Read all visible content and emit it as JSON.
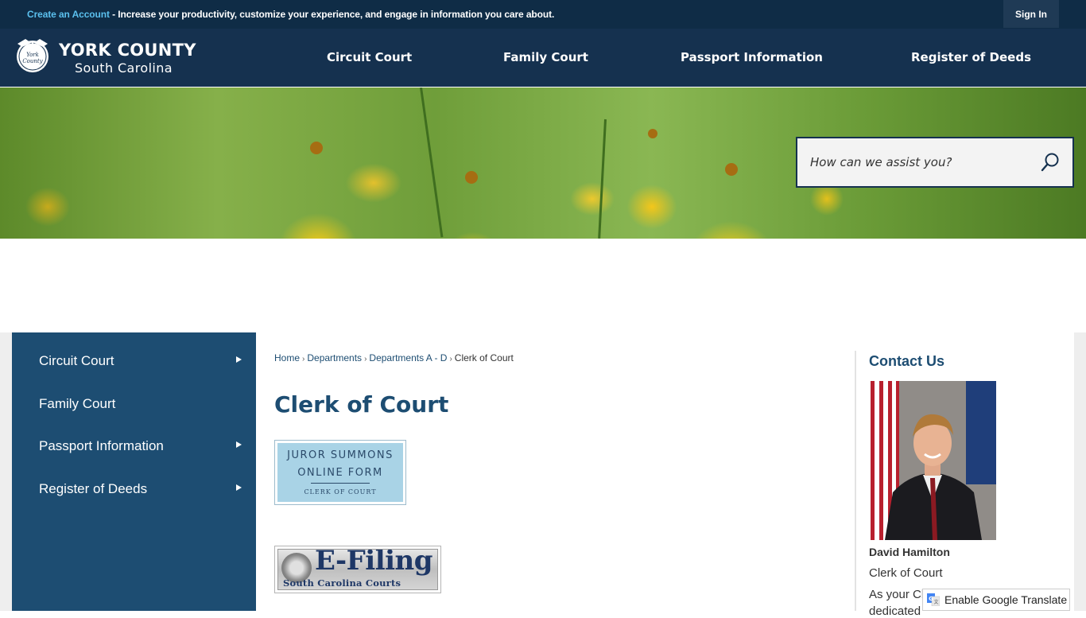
{
  "topbar": {
    "create_account_link": "Create an Account",
    "message": " - Increase your productivity, customize your experience, and engage in information you care about.",
    "sign_in_label": "Sign In"
  },
  "header": {
    "logo_title": "YORK COUNTY",
    "logo_subtitle": "South Carolina",
    "seal_text": "York County",
    "nav": [
      {
        "label": "Circuit Court"
      },
      {
        "label": "Family Court"
      },
      {
        "label": "Passport Information"
      },
      {
        "label": "Register of Deeds"
      }
    ]
  },
  "search": {
    "placeholder": "How can we assist you?",
    "value": ""
  },
  "sidenav": {
    "items": [
      {
        "label": "Circuit Court",
        "has_submenu": true
      },
      {
        "label": "Family Court",
        "has_submenu": false
      },
      {
        "label": "Passport Information",
        "has_submenu": true
      },
      {
        "label": "Register of Deeds",
        "has_submenu": true
      }
    ]
  },
  "breadcrumb": {
    "items": [
      {
        "label": "Home"
      },
      {
        "label": "Departments"
      },
      {
        "label": "Departments A - D"
      },
      {
        "label": "Clerk of Court"
      }
    ],
    "separator": "›"
  },
  "main": {
    "title": "Clerk of Court",
    "juror_graphic": {
      "line1": "JUROR SUMMONS",
      "line2": "ONLINE FORM",
      "line3": "CLERK OF COURT"
    },
    "efiling_graphic": {
      "title": "E-Filing",
      "subtitle": "South Carolina Courts"
    }
  },
  "contact": {
    "heading": "Contact Us",
    "name": "David Hamilton",
    "role": "Clerk of Court",
    "text_line1": "As your Cl",
    "text_line2": "dedicated"
  },
  "translate": {
    "label": "Enable Google Translate"
  },
  "colors": {
    "topbar_bg": "#0f2c46",
    "header_bg": "#15314f",
    "sidenav_bg": "#1d4d72",
    "accent_link": "#5bc0ee",
    "heading_color": "#1d4d72"
  }
}
